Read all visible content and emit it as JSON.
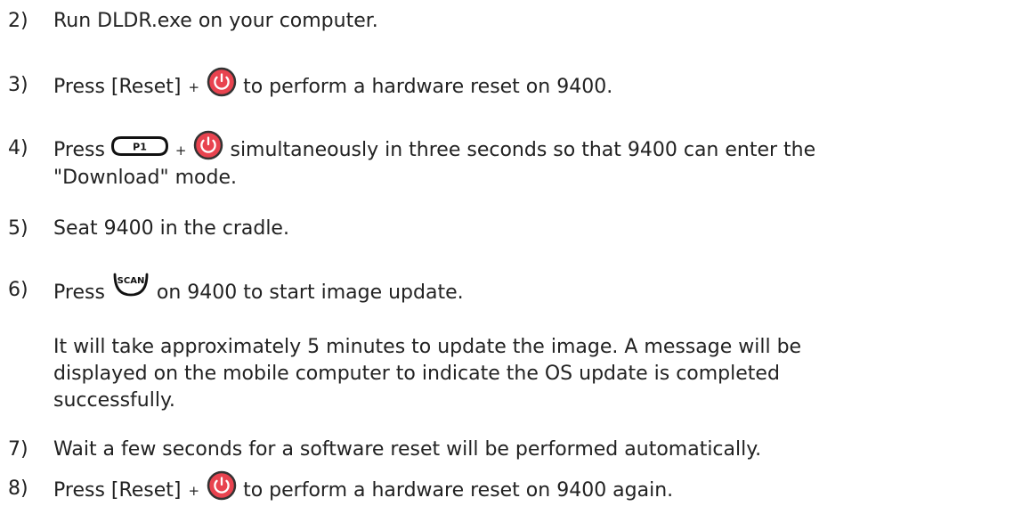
{
  "steps": {
    "s2": {
      "num": "2)",
      "text": "Run DLDR.exe on your computer."
    },
    "s3": {
      "num": "3)",
      "a": "Press [Reset]",
      "plus": "+",
      "b": "to perform a hardware reset on 9400."
    },
    "s4": {
      "num": "4)",
      "a": "Press",
      "plus": "+",
      "b": "simultaneously in three seconds so that 9400 can enter the",
      "c": "\"Download\" mode."
    },
    "s5": {
      "num": "5)",
      "text": "Seat 9400 in the cradle."
    },
    "s6": {
      "num": "6)",
      "a": "Press",
      "b": "on 9400 to start image update."
    },
    "note": {
      "l1": "It will take approximately 5 minutes to update the image. A message will be",
      "l2": "displayed on the mobile computer to indicate the OS update is completed",
      "l3": "successfully."
    },
    "s7": {
      "num": "7)",
      "text": "Wait a few seconds for a software reset will be performed automatically."
    },
    "s8": {
      "num": "8)",
      "a": "Press [Reset]",
      "plus": "+",
      "b": "to perform a hardware reset on 9400 again."
    }
  },
  "icons": {
    "power": "power-button-icon",
    "p1": "p1-key-icon",
    "scan": "scan-key-icon"
  },
  "colors": {
    "power_red": "#e8434f",
    "text": "#222222"
  },
  "key_labels": {
    "p1": "P1",
    "scan": "SCAN"
  }
}
